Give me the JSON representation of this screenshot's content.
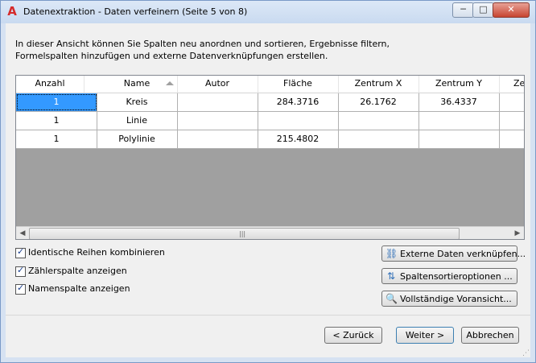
{
  "window": {
    "title": "Datenextraktion - Daten verfeinern (Seite 5 von 8)",
    "app_icon": "A",
    "minimize_label": "─",
    "maximize_label": "□",
    "close_label": "✕"
  },
  "intro": "In dieser Ansicht können Sie Spalten neu anordnen und sortieren, Ergebnisse filtern, Formelspalten hinzufügen und externe Datenverknüpfungen erstellen.",
  "table": {
    "headers": [
      "Anzahl",
      "Name",
      "Autor",
      "Fläche",
      "Zentrum X",
      "Zentrum Y",
      "Ze"
    ],
    "rows": [
      [
        "1",
        "Kreis",
        "",
        "284.3716",
        "26.1762",
        "36.4337",
        ""
      ],
      [
        "1",
        "Linie",
        "",
        "",
        "",
        "",
        ""
      ],
      [
        "1",
        "Polylinie",
        "",
        "215.4802",
        "",
        "",
        ""
      ]
    ]
  },
  "scrollbar": {
    "left_arrow": "◀",
    "right_arrow": "▶",
    "grip": "|||"
  },
  "checkboxes": [
    {
      "label": "Identische Reihen kombinieren",
      "checked": true
    },
    {
      "label": "Zählerspalte anzeigen",
      "checked": true
    },
    {
      "label": "Namenspalte anzeigen",
      "checked": true
    }
  ],
  "side_buttons": [
    {
      "label": "Externe Daten verknüpfen...",
      "icon": "link-icon"
    },
    {
      "label": "Spaltensortieroptionen ...",
      "icon": "sort-icon"
    },
    {
      "label": "Vollständige Voransicht...",
      "icon": "preview-icon"
    }
  ],
  "nav": {
    "back": "< Zurück",
    "next": "Weiter >",
    "cancel": "Abbrechen"
  }
}
